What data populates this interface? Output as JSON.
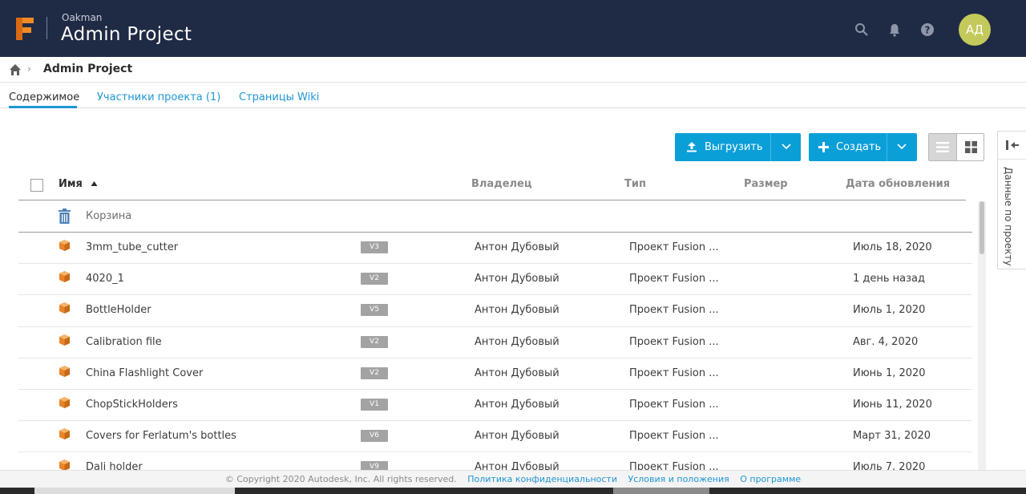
{
  "header": {
    "org": "Oakman",
    "project": "Admin Project",
    "avatar_initials": "АД",
    "icons": [
      "fusion-logo-icon",
      "search-icon",
      "bell-icon",
      "help-icon"
    ]
  },
  "breadcrumb": {
    "current": "Admin Project"
  },
  "tabs": [
    {
      "label": "Содержимое",
      "active": true
    },
    {
      "label": "Участники проекта (1)",
      "active": false
    },
    {
      "label": "Страницы Wiki",
      "active": false
    }
  ],
  "toolbar": {
    "upload_label": "Выгрузить",
    "create_label": "Создать"
  },
  "side_panel": {
    "label": "Данные по проекту"
  },
  "table": {
    "headers": {
      "name": "Имя",
      "owner": "Владелец",
      "type": "Тип",
      "size": "Размер",
      "updated": "Дата обновления"
    },
    "sort": "name-ascending",
    "trash_label": "Корзина",
    "rows": [
      {
        "name": "3mm_tube_cutter",
        "version": "V3",
        "owner": "Антон Дубовый",
        "type": "Проект Fusion ...",
        "date": "Июль 18, 2020"
      },
      {
        "name": "4020_1",
        "version": "V2",
        "owner": "Антон Дубовый",
        "type": "Проект Fusion ...",
        "date": "1 день назад"
      },
      {
        "name": "BottleHolder",
        "version": "V5",
        "owner": "Антон Дубовый",
        "type": "Проект Fusion ...",
        "date": "Июль 1, 2020"
      },
      {
        "name": "Calibration file",
        "version": "V2",
        "owner": "Антон Дубовый",
        "type": "Проект Fusion ...",
        "date": "Авг. 4, 2020"
      },
      {
        "name": "China Flashlight Cover",
        "version": "V2",
        "owner": "Антон Дубовый",
        "type": "Проект Fusion ...",
        "date": "Июнь 1, 2020"
      },
      {
        "name": "ChopStickHolders",
        "version": "V1",
        "owner": "Антон Дубовый",
        "type": "Проект Fusion ...",
        "date": "Июнь 11, 2020"
      },
      {
        "name": "Covers for Ferlatum's bottles",
        "version": "V6",
        "owner": "Антон Дубовый",
        "type": "Проект Fusion ...",
        "date": "Март 31, 2020"
      },
      {
        "name": "Dali holder",
        "version": "V9",
        "owner": "Антон Дубовый",
        "type": "Проект Fusion ...",
        "date": "Июль 7, 2020"
      }
    ]
  },
  "footer": {
    "copyright": "© Copyright 2020 Autodesk, Inc. All rights reserved.",
    "links": [
      "Политика конфиденциальности",
      "Условия и положения",
      "О программе"
    ]
  },
  "colors": {
    "topbar": "#1f2a44",
    "accent": "#0b9fd8",
    "avatar": "#c3c95b",
    "file_icon": "#e8852a"
  }
}
